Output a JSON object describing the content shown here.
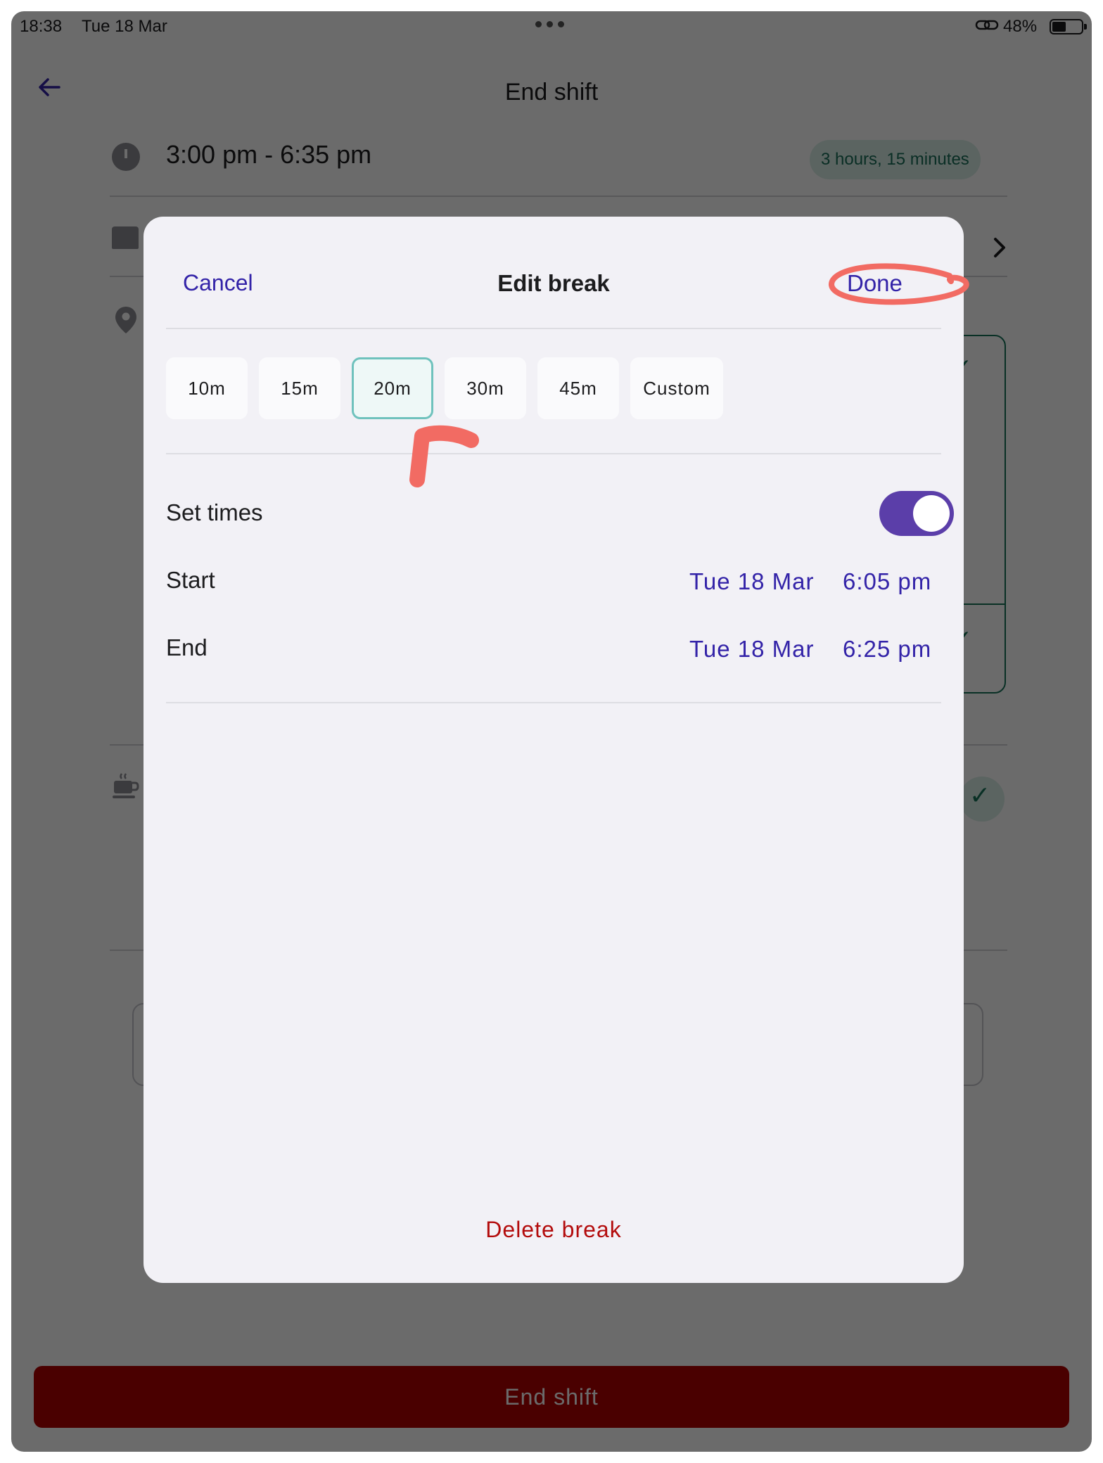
{
  "status_bar": {
    "time": "18:38",
    "date": "Tue 18 Mar",
    "battery_percent": "48%",
    "battery_level": 0.48
  },
  "header": {
    "title": "End shift",
    "back_icon": "arrow-left-icon"
  },
  "shift": {
    "time_range": "3:00 pm - 6:35 pm",
    "duration": "3 hours, 15 minutes"
  },
  "modal": {
    "cancel_label": "Cancel",
    "title": "Edit break",
    "done_label": "Done",
    "chips": [
      "10m",
      "15m",
      "20m",
      "30m",
      "45m",
      "Custom"
    ],
    "selected_chip": "20m",
    "set_times_label": "Set times",
    "set_times_on": true,
    "start": {
      "label": "Start",
      "date": "Tue 18 Mar",
      "time": "6:05 pm"
    },
    "end": {
      "label": "End",
      "date": "Tue 18 Mar",
      "time": "6:25 pm"
    },
    "delete_label": "Delete break"
  },
  "footer": {
    "end_shift_label": "End shift"
  },
  "colors": {
    "accent": "#3323a8",
    "toggle": "#5b3ea9",
    "danger": "#b30c0c",
    "teal": "#16735a",
    "annotation": "#f26b63"
  }
}
